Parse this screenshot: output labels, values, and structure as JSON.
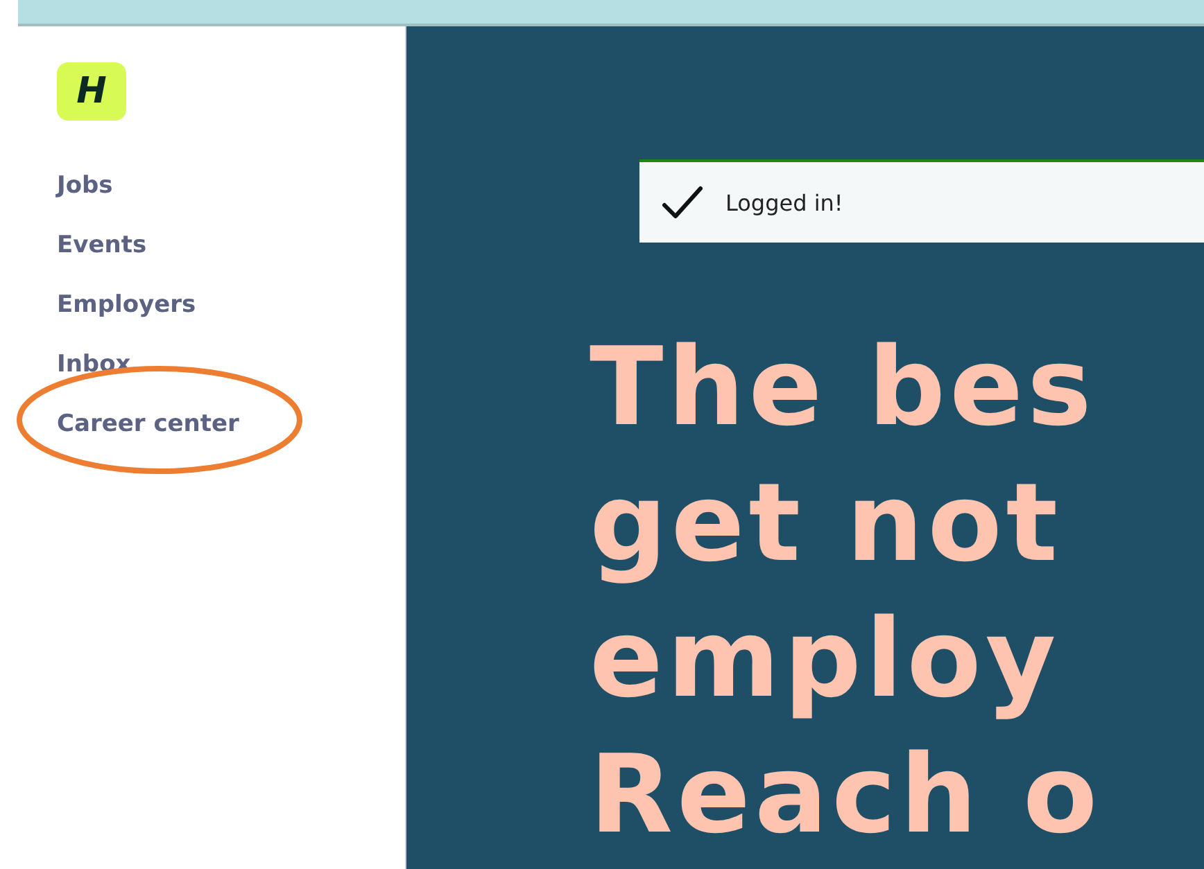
{
  "logo": {
    "letter": "H"
  },
  "nav": [
    {
      "label": "Jobs"
    },
    {
      "label": "Events"
    },
    {
      "label": "Employers"
    },
    {
      "label": "Inbox"
    },
    {
      "label": "Career center"
    }
  ],
  "toast": {
    "message": "Logged in!"
  },
  "headline": [
    "The bes",
    "get not",
    "employ",
    "Reach o"
  ]
}
